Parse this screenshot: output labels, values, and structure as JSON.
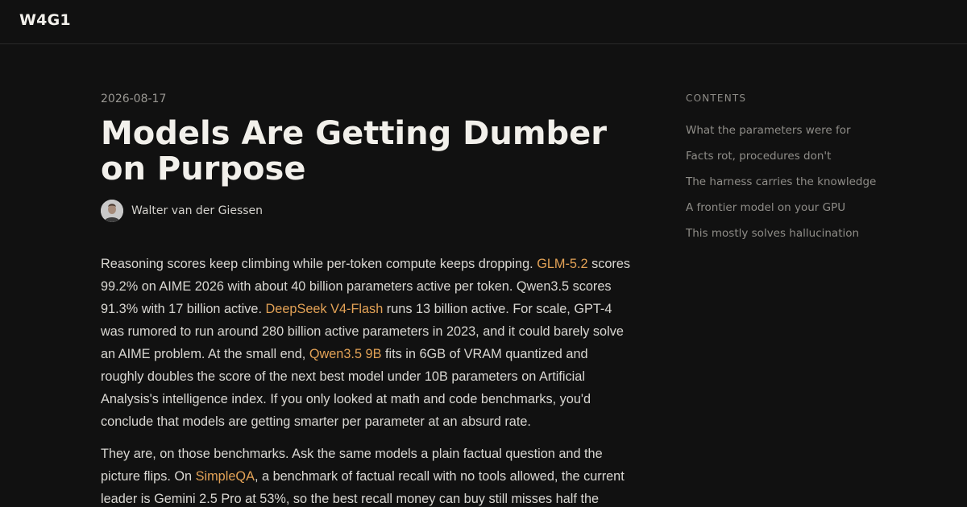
{
  "header": {
    "logo": "W4G1"
  },
  "post": {
    "date": "2026-08-17",
    "title": "Models Are Getting Dumber on Purpose",
    "author": "Walter van der Giessen",
    "paragraphs": [
      {
        "segments": [
          {
            "text": "Reasoning scores keep climbing while per-token compute keeps dropping. "
          },
          {
            "text": "GLM-5.2",
            "link": true
          },
          {
            "text": " scores 99.2% on AIME 2026 with about 40 billion parameters active per token. Qwen3.5 scores 91.3% with 17 billion active. "
          },
          {
            "text": "DeepSeek V4-Flash",
            "link": true
          },
          {
            "text": " runs 13 billion active. For scale, GPT-4 was rumored to run around 280 billion active parameters in 2023, and it could barely solve an AIME problem. At the small end, "
          },
          {
            "text": "Qwen3.5 9B",
            "link": true
          },
          {
            "text": " fits in 6GB of VRAM quantized and roughly doubles the score of the next best model under 10B parameters on Artificial Analysis's intelligence index. If you only looked at math and code benchmarks, you'd conclude that models are getting smarter per parameter at an absurd rate."
          }
        ]
      },
      {
        "segments": [
          {
            "text": "They are, on those benchmarks. Ask the same models a plain factual question and the picture flips. On "
          },
          {
            "text": "SimpleQA",
            "link": true
          },
          {
            "text": ", a benchmark of factual recall with no tools allowed, the current leader is Gemini 2.5 Pro at 53%, so the best recall money can buy still misses half the"
          }
        ]
      }
    ]
  },
  "toc": {
    "heading": "CONTENTS",
    "items": [
      {
        "label": "What the parameters were for"
      },
      {
        "label": "Facts rot, procedures don't"
      },
      {
        "label": "The harness carries the knowledge"
      },
      {
        "label": "A frontier model on your GPU"
      },
      {
        "label": "This mostly solves hallucination"
      }
    ]
  },
  "colors": {
    "background": "#111111",
    "link": "#e3a256",
    "text": "#d9d7d2",
    "muted": "#8f8d88"
  }
}
